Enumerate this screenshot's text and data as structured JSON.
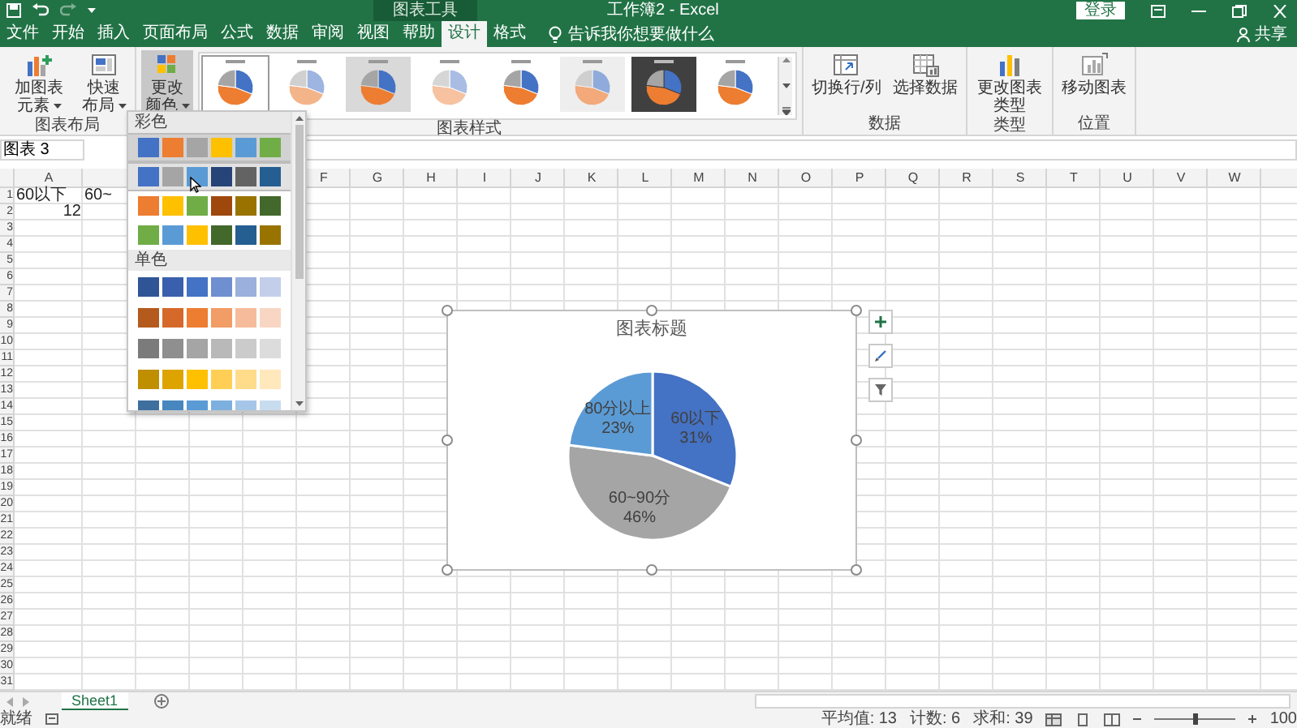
{
  "title_bar": {
    "context_label": "图表工具",
    "title": "工作簿2 - Excel",
    "sign_in": "登录"
  },
  "ribbon_tabs": [
    {
      "label": "文件",
      "selected": false
    },
    {
      "label": "开始",
      "selected": false
    },
    {
      "label": "插入",
      "selected": false
    },
    {
      "label": "页面布局",
      "selected": false
    },
    {
      "label": "公式",
      "selected": false
    },
    {
      "label": "数据",
      "selected": false
    },
    {
      "label": "审阅",
      "selected": false
    },
    {
      "label": "视图",
      "selected": false
    },
    {
      "label": "帮助",
      "selected": false
    },
    {
      "label": "设计",
      "selected": true
    },
    {
      "label": "格式",
      "selected": false
    }
  ],
  "tell_me": {
    "placeholder": "告诉我你想要做什么"
  },
  "share": "共享",
  "ribbon_groups": [
    {
      "label": "图表布局",
      "buttons": [
        {
          "label": "加图表元素",
          "pressed": false
        },
        {
          "label": "快速布局",
          "pressed": false
        }
      ]
    },
    {
      "label": "图表样式",
      "buttons": [
        {
          "label": "更改颜色",
          "pressed": true
        }
      ],
      "styles": [
        {
          "kind": "plain",
          "selected": true
        },
        {
          "kind": "hatched",
          "selected": false
        },
        {
          "kind": "shaded",
          "selected": false
        },
        {
          "kind": "pale",
          "selected": false
        },
        {
          "kind": "plain",
          "selected": false
        },
        {
          "kind": "textured",
          "selected": false
        },
        {
          "kind": "dark",
          "selected": false
        },
        {
          "kind": "plain",
          "selected": false
        }
      ]
    },
    {
      "label": "数据",
      "buttons": [
        {
          "label": "切换行/列",
          "pressed": false
        },
        {
          "label": "选择数据",
          "pressed": false
        }
      ]
    },
    {
      "label": "类型",
      "buttons": [
        {
          "label": "更改图表类型",
          "pressed": false
        }
      ]
    },
    {
      "label": "位置",
      "buttons": [
        {
          "label": "移动图表",
          "pressed": false
        }
      ]
    }
  ],
  "name_box": "图表 3",
  "sheet": {
    "columns": [
      "A",
      "F",
      "G",
      "H",
      "I",
      "J",
      "K",
      "L",
      "M",
      "N",
      "O",
      "P",
      "Q",
      "R",
      "S",
      "T",
      "U",
      "V",
      "W"
    ],
    "rows": [
      {
        "number": "1",
        "cells": [
          {
            "kind": "text",
            "text": "60以下"
          },
          {
            "kind": "text",
            "text": "60~"
          }
        ]
      },
      {
        "number": "2",
        "cells": [
          {
            "kind": "number",
            "text": "12"
          }
        ]
      },
      {
        "number": "3"
      },
      {
        "number": "4"
      },
      {
        "number": "5"
      },
      {
        "number": "6"
      },
      {
        "number": "7"
      },
      {
        "number": "8"
      },
      {
        "number": "9"
      },
      {
        "number": "10"
      },
      {
        "number": "11"
      },
      {
        "number": "12"
      },
      {
        "number": "13"
      },
      {
        "number": "14"
      },
      {
        "number": "15"
      },
      {
        "number": "16"
      },
      {
        "number": "17"
      },
      {
        "number": "18"
      },
      {
        "number": "19"
      },
      {
        "number": "20"
      },
      {
        "number": "21"
      },
      {
        "number": "22"
      },
      {
        "number": "23"
      },
      {
        "number": "24"
      },
      {
        "number": "25"
      },
      {
        "number": "26"
      },
      {
        "number": "27"
      },
      {
        "number": "28"
      },
      {
        "number": "29"
      },
      {
        "number": "30"
      },
      {
        "number": "31"
      }
    ]
  },
  "chart": {
    "chart_data": {
      "type": "pie",
      "title": "图表标题",
      "categories": [
        "60以下",
        "60~90分",
        "80分以上"
      ],
      "values": [
        31,
        46,
        23
      ],
      "data_labels": true,
      "value_labels": [
        "31%",
        "46%",
        "23%"
      ]
    }
  },
  "color_dropdown": {
    "sections": [
      {
        "label": "彩色",
        "rows": [
          {
            "selected": true,
            "hovered": false,
            "swatches": [
              {
                "color": "#4472c4"
              },
              {
                "color": "#ed7d31"
              },
              {
                "color": "#a5a5a5"
              },
              {
                "color": "#ffc000"
              },
              {
                "color": "#5b9bd5"
              },
              {
                "color": "#70ad47"
              }
            ]
          },
          {
            "selected": false,
            "hovered": true,
            "swatches": [
              {
                "color": "#4472c4"
              },
              {
                "color": "#a5a5a5"
              },
              {
                "color": "#5b9bd5"
              },
              {
                "color": "#264478"
              },
              {
                "color": "#636363"
              },
              {
                "color": "#255e91"
              }
            ]
          },
          {
            "selected": false,
            "hovered": false,
            "swatches": [
              {
                "color": "#ed7d31"
              },
              {
                "color": "#ffc000"
              },
              {
                "color": "#70ad47"
              },
              {
                "color": "#9e480e"
              },
              {
                "color": "#997300"
              },
              {
                "color": "#43682b"
              }
            ]
          },
          {
            "selected": false,
            "hovered": false,
            "swatches": [
              {
                "color": "#70ad47"
              },
              {
                "color": "#5b9bd5"
              },
              {
                "color": "#ffc000"
              },
              {
                "color": "#43682b"
              },
              {
                "color": "#255e91"
              },
              {
                "color": "#997300"
              }
            ]
          }
        ]
      },
      {
        "label": "单色",
        "rows": [
          {
            "selected": false,
            "hovered": false,
            "swatches": [
              {
                "color": "#2f5597"
              },
              {
                "color": "#3a5fad"
              },
              {
                "color": "#4472c4"
              },
              {
                "color": "#6f8fd0"
              },
              {
                "color": "#9bb0dd"
              },
              {
                "color": "#c3cfea"
              }
            ]
          },
          {
            "selected": false,
            "hovered": false,
            "swatches": [
              {
                "color": "#b45a1d"
              },
              {
                "color": "#d5692a"
              },
              {
                "color": "#ed7d31"
              },
              {
                "color": "#f29c66"
              },
              {
                "color": "#f6bb9a"
              },
              {
                "color": "#f9d6c3"
              }
            ]
          },
          {
            "selected": false,
            "hovered": false,
            "swatches": [
              {
                "color": "#7b7b7b"
              },
              {
                "color": "#8f8f8f"
              },
              {
                "color": "#a5a5a5"
              },
              {
                "color": "#b9b9b9"
              },
              {
                "color": "#cbcbcb"
              },
              {
                "color": "#dcdcdc"
              }
            ]
          },
          {
            "selected": false,
            "hovered": false,
            "swatches": [
              {
                "color": "#bf8f00"
              },
              {
                "color": "#dda400"
              },
              {
                "color": "#ffc000"
              },
              {
                "color": "#ffcf55"
              },
              {
                "color": "#ffdc8a"
              },
              {
                "color": "#ffe8bc"
              }
            ]
          },
          {
            "selected": false,
            "hovered": false,
            "swatches": [
              {
                "color": "#3d6f9f"
              },
              {
                "color": "#4886c0"
              },
              {
                "color": "#5b9bd5"
              },
              {
                "color": "#7eb0df"
              },
              {
                "color": "#a5c6e8"
              },
              {
                "color": "#c8dcf0"
              }
            ]
          }
        ]
      }
    ]
  },
  "sheet_tabs": [
    {
      "label": "Sheet1",
      "selected": true
    }
  ],
  "status_bar": {
    "mode": "就绪",
    "stats": [
      "平均值: 13",
      "计数: 6",
      "求和: 39"
    ],
    "zoom_slider": {
      "level": 0.5
    },
    "zoom": "100"
  }
}
